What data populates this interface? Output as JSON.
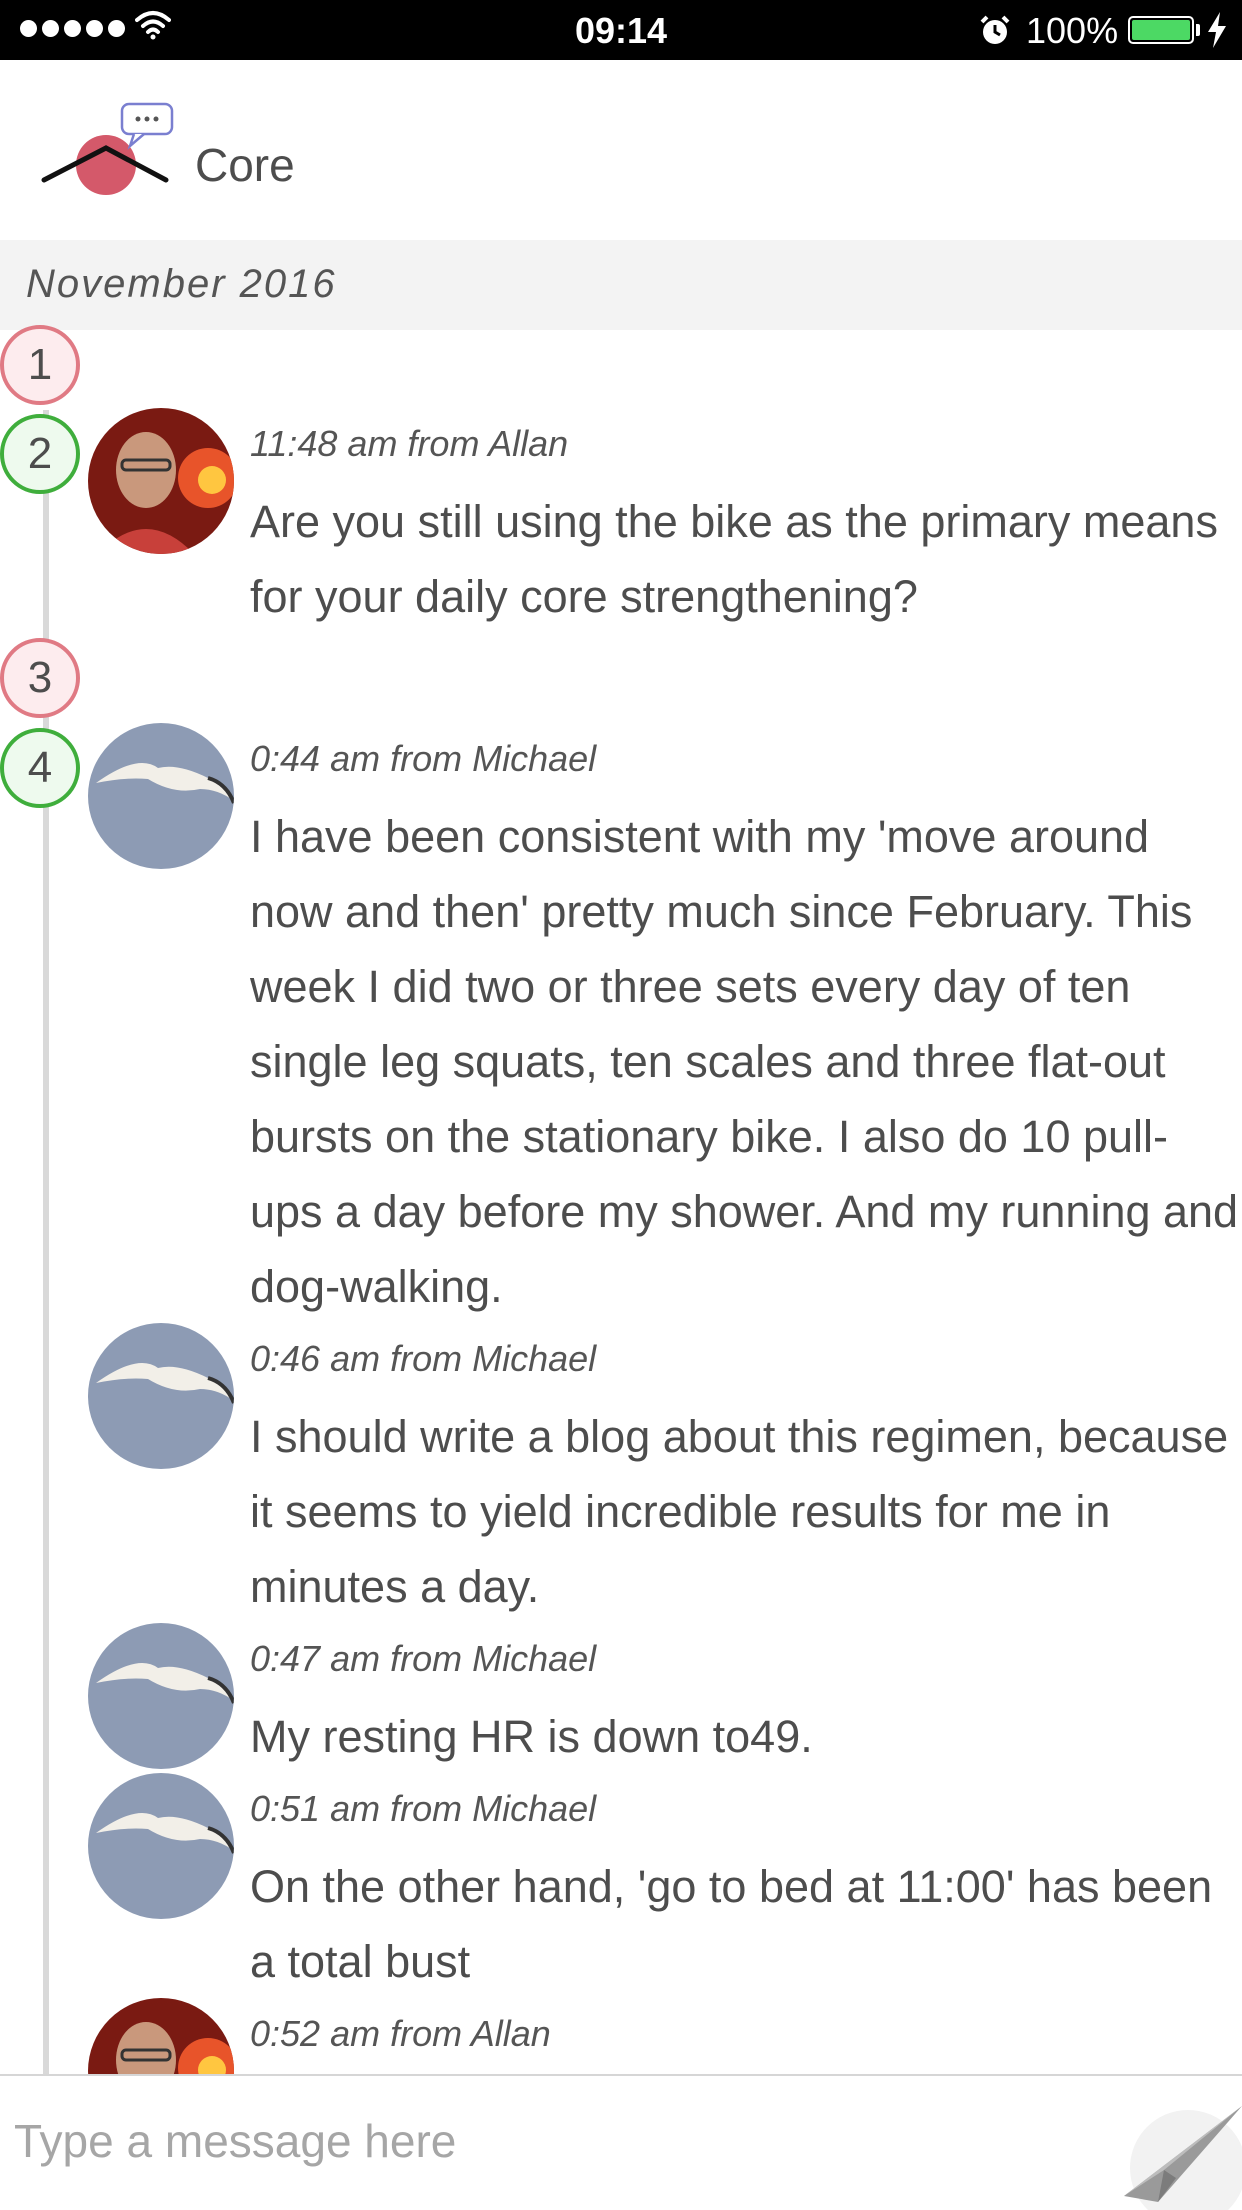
{
  "status_bar": {
    "time": "09:14",
    "battery": "100%",
    "icons": [
      "signal-dots-icon",
      "wifi-icon",
      "alarm-icon",
      "battery-icon",
      "charging-bolt-icon"
    ]
  },
  "header": {
    "title": "Core",
    "logo_icon": "core-logo-icon"
  },
  "month": "November 2016",
  "timeline": {
    "markers": [
      "1",
      "2",
      "3",
      "4"
    ]
  },
  "messages": [
    {
      "meta": "11:48 am from Allan",
      "text": "Are you still using the bike as the primary means for your daily core strengthening?"
    },
    {
      "meta": "0:44 am from Michael",
      "text": "I have been consistent with my 'move around now and then' pretty much since February. This week I did two or three sets every day of ten single leg squats, ten scales and three flat-out bursts on the stationary bike. I also do 10 pull-ups a day before my shower. And my running and dog-walking."
    },
    {
      "meta": "0:46 am from Michael",
      "text": "I should write a blog about this regimen, because it seems to yield incredible results for me in minutes a day."
    },
    {
      "meta": "0:47 am from Michael",
      "text": "My resting HR is down to49."
    },
    {
      "meta": "0:51 am from Michael",
      "text": "On the other hand, 'go to bed at 11:00' has been a total bust"
    },
    {
      "meta": "0:52 am from Allan",
      "text": ""
    }
  ],
  "composer": {
    "placeholder": "Type a message here",
    "send_icon": "paper-plane-icon"
  },
  "colors": {
    "marker_red": "#e07a84",
    "marker_green": "#3fae3c",
    "logo_red": "#d4596a",
    "battery_green": "#4cd964"
  }
}
